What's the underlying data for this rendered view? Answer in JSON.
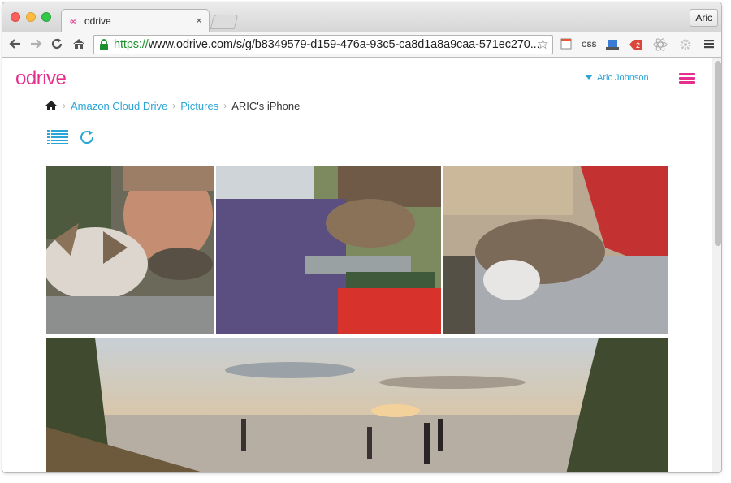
{
  "browser": {
    "tab_title": "odrive",
    "tab_favicon": "∞",
    "tab_close": "×",
    "profile_name": "Aric",
    "url_scheme": "https://",
    "url_rest": "www.odrive.com/s/g/b8349579-d159-476a-93c5-ca8d1a8a9caa-571ec270...",
    "extensions": [
      "page-icon",
      "CSS",
      "network-icon",
      "2",
      "react-icon",
      "gear-icon",
      "menu-icon"
    ]
  },
  "app": {
    "logo": "odrive",
    "brand_color": "#e62e8c",
    "link_color": "#2aa6d6",
    "user_name": "Aric Johnson"
  },
  "breadcrumb": {
    "home_icon": "home-icon",
    "items": [
      "Amazon Cloud Drive",
      "Pictures"
    ],
    "current": "ARIC's iPhone"
  },
  "actions": {
    "list_view_icon": "list-view-icon",
    "refresh_icon": "refresh-icon"
  },
  "photos": [
    {
      "subject": "man with cat selfie"
    },
    {
      "subject": "cat on bench with person"
    },
    {
      "subject": "cat sleeping on lap"
    },
    {
      "subject": "beach panorama at sunset"
    }
  ]
}
